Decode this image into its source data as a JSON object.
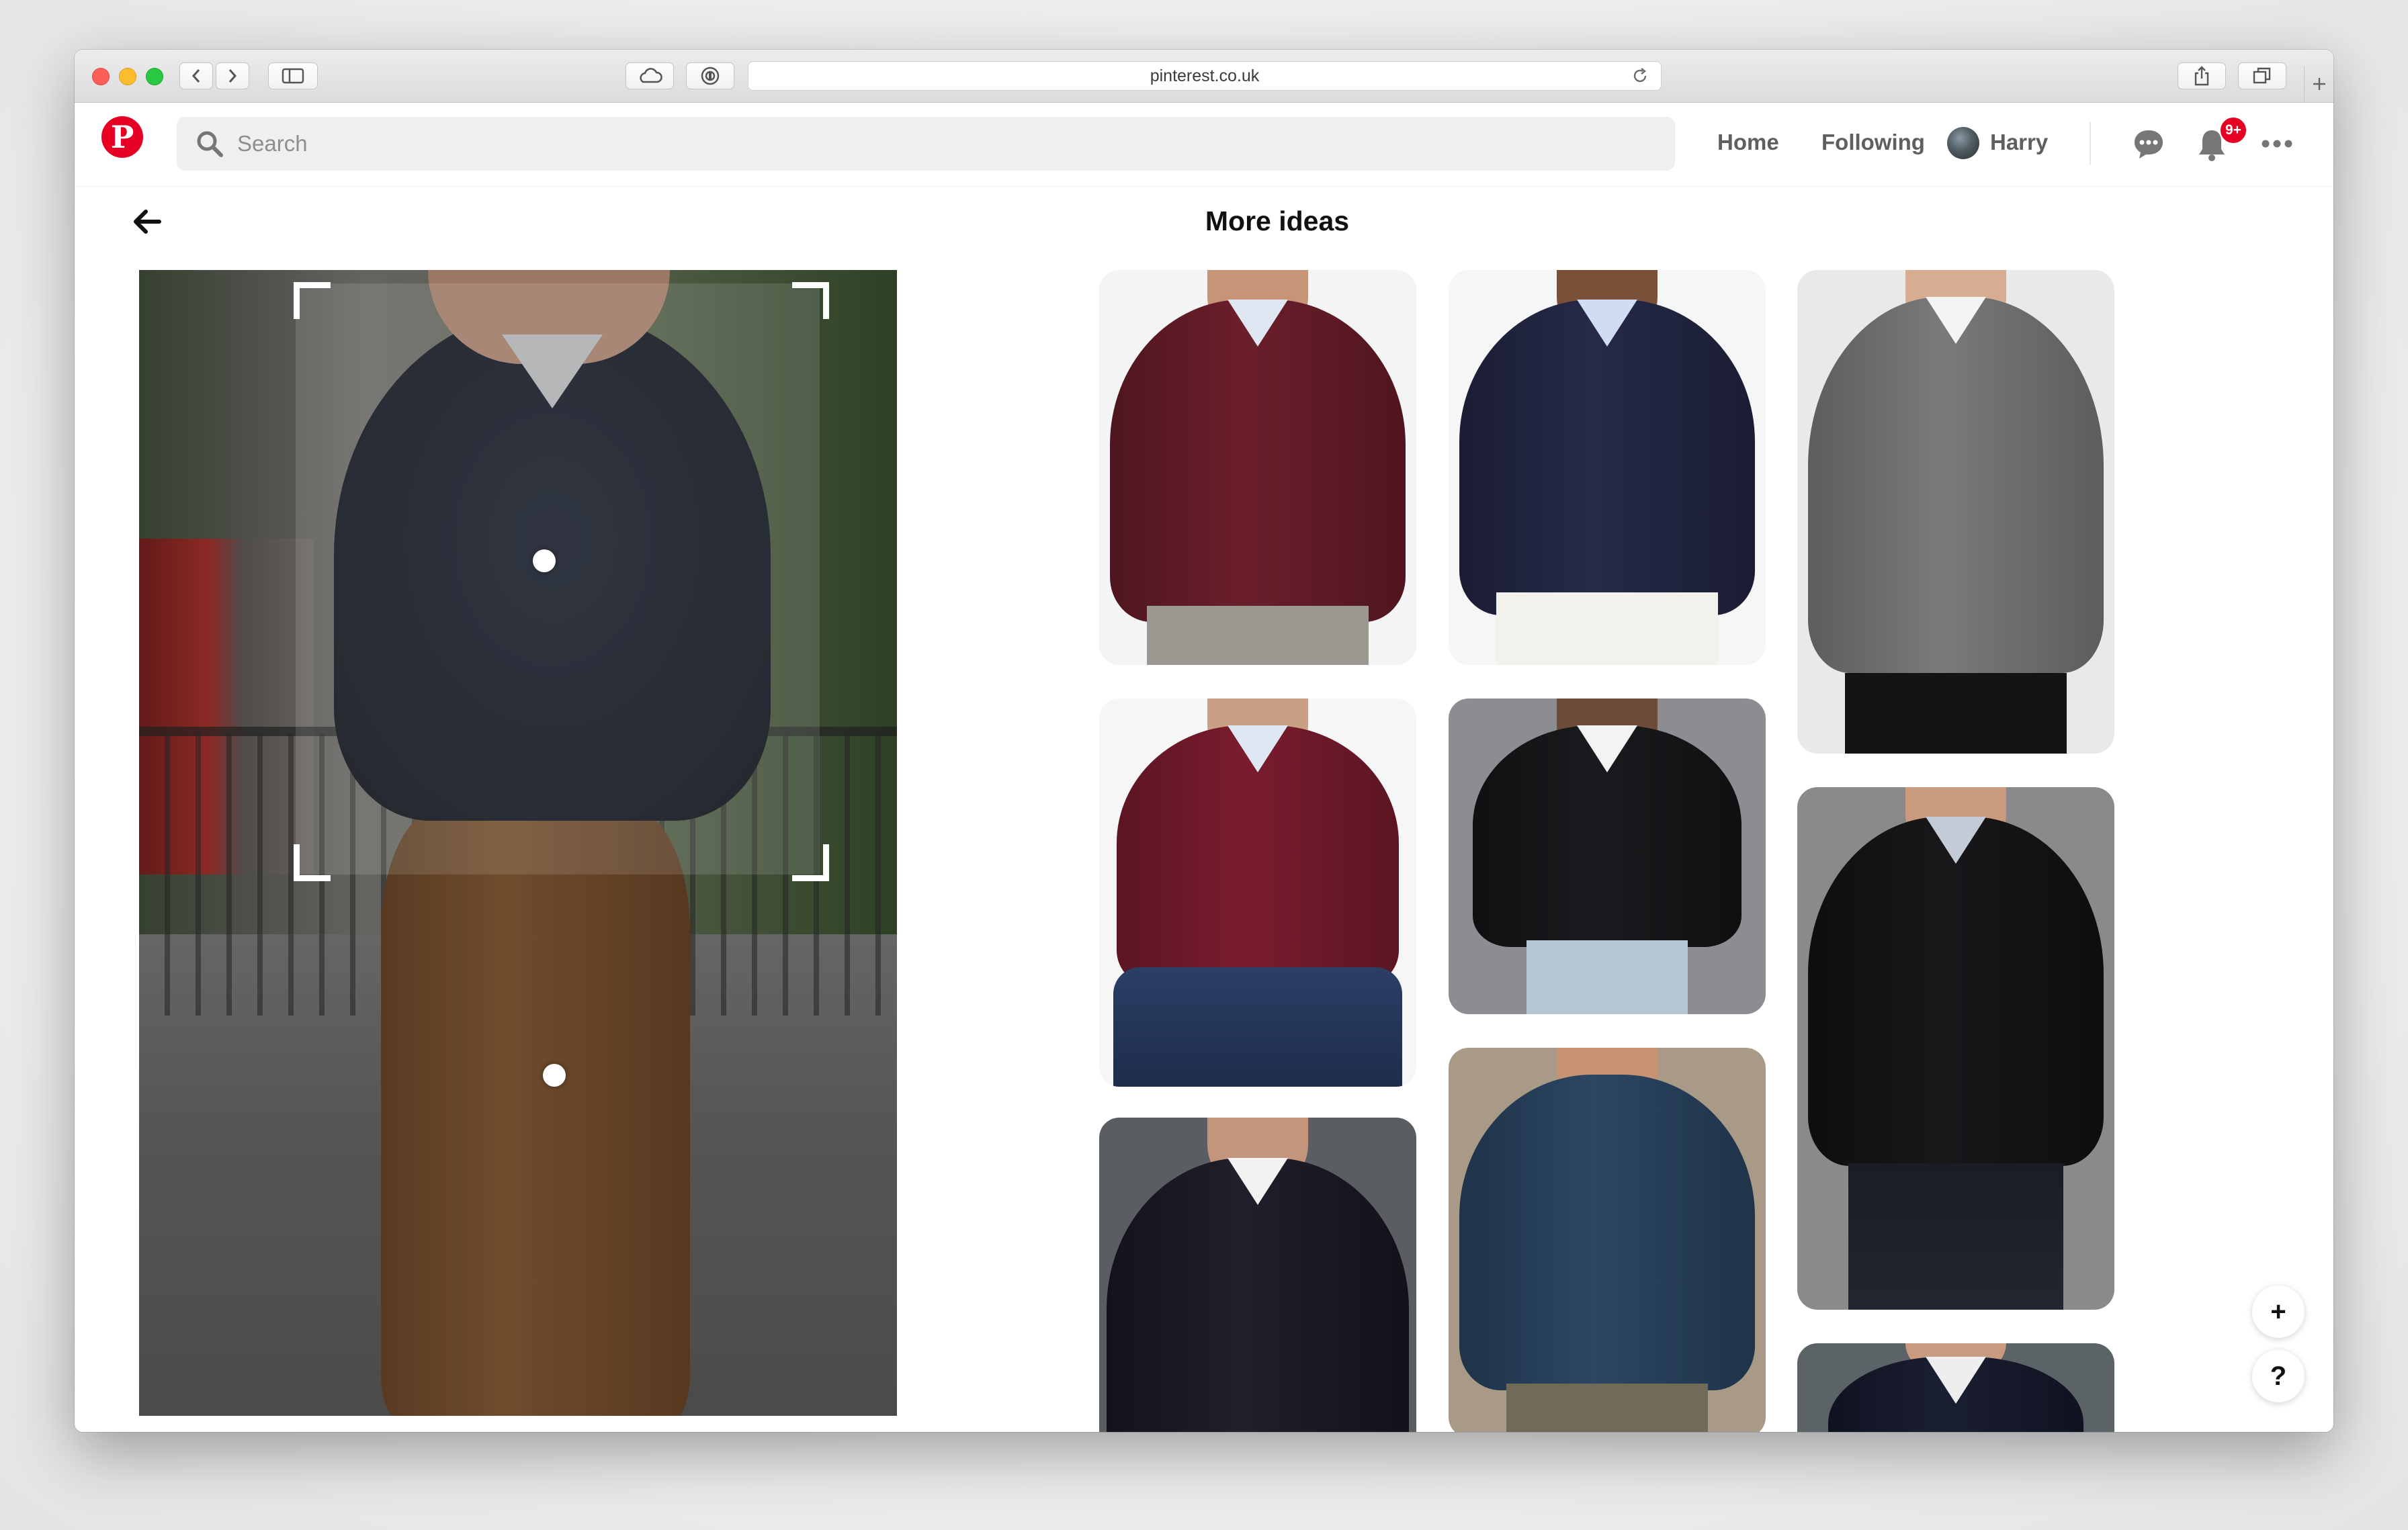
{
  "browser": {
    "url": "pinterest.co.uk"
  },
  "header": {
    "logo_letter": "P",
    "search_placeholder": "Search",
    "nav": {
      "home": "Home",
      "following": "Following",
      "user_name": "Harry"
    },
    "notification_badge": "9+"
  },
  "main": {
    "section_title": "More ideas"
  },
  "floating": {
    "add": "+",
    "help": "?"
  },
  "colors": {
    "brand_red": "#e60023",
    "nav_text": "#5f5f5f",
    "search_bg": "#efefef"
  },
  "icons": [
    "back-arrow-icon",
    "search-icon",
    "chat-icon",
    "bell-icon",
    "more-icon",
    "share-icon",
    "tabs-icon",
    "sidebar-icon",
    "cloud-icon",
    "privacy-icon",
    "reload-icon"
  ]
}
